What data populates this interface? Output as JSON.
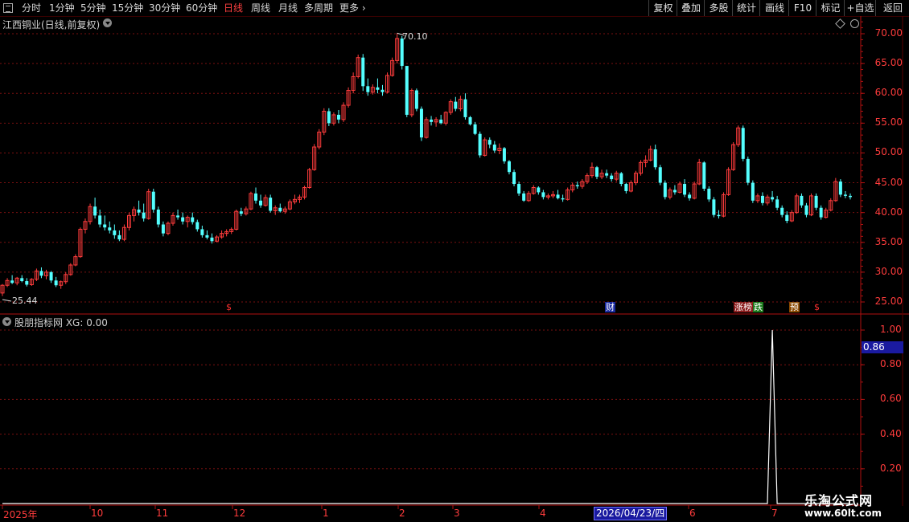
{
  "toolbar": {
    "periods": [
      "分时",
      "1分钟",
      "5分钟",
      "15分钟",
      "30分钟",
      "60分钟",
      "日线",
      "周线",
      "月线",
      "多周期",
      "更多"
    ],
    "active_period": "日线",
    "right_buttons": [
      "复权",
      "叠加",
      "多股",
      "统计",
      "画线",
      "F10",
      "标记",
      "+自选",
      "返回"
    ]
  },
  "main": {
    "title": "江西铜业(日线,前复权)",
    "high_label": "70.10",
    "low_label": "25.44",
    "y_ticks": [
      "70.00",
      "65.00",
      "60.00",
      "55.00",
      "50.00",
      "45.00",
      "40.00",
      "35.00",
      "30.00",
      "25.00"
    ],
    "markers": [
      {
        "text": "$",
        "color": "#ff3030",
        "bg": "#000"
      },
      {
        "text": "财",
        "color": "#ffffff",
        "bg": "#1a2aa0"
      },
      {
        "text": "涨榜",
        "color": "#ffffff",
        "bg": "#8a1a1a"
      },
      {
        "text": "跌",
        "color": "#ffffff",
        "bg": "#1a7a1a"
      },
      {
        "text": "预",
        "color": "#ffffff",
        "bg": "#8a4a00"
      },
      {
        "text": "$",
        "color": "#ff3030",
        "bg": "#000"
      }
    ]
  },
  "indicator": {
    "title": "股朋指标网 XG: 0.00",
    "y_ticks": [
      "1.00",
      "0.80",
      "0.60",
      "0.40",
      "0.20"
    ],
    "current_value": "0.86"
  },
  "date_axis": {
    "labels": [
      "2025年",
      "10",
      "11",
      "12",
      "1",
      "2",
      "3",
      "4",
      "6",
      "7"
    ],
    "selected": "2026/04/23/四"
  },
  "watermark": {
    "line1": "乐淘公式网",
    "line2": "www.60lt.com"
  },
  "colors": {
    "up": "#ff3c3c",
    "down": "#54ffff",
    "grid": "#7a1010",
    "indicator_line": "#ffffff",
    "frame": "#b01010"
  },
  "chart_data": {
    "type": "candlestick",
    "ylim": [
      24,
      71
    ],
    "candles": [
      [
        26.5,
        28,
        26,
        27.8
      ],
      [
        27.8,
        29,
        27.5,
        28.6
      ],
      [
        28.6,
        29.5,
        28,
        28.2
      ],
      [
        28.2,
        29.2,
        27.8,
        29
      ],
      [
        29,
        29.5,
        28.3,
        28.5
      ],
      [
        28.5,
        29,
        27.6,
        27.9
      ],
      [
        27.9,
        29,
        27.7,
        28.8
      ],
      [
        28.8,
        30.6,
        28.5,
        30.2
      ],
      [
        30.2,
        30.8,
        29,
        29.4
      ],
      [
        29.4,
        30.4,
        28.8,
        30
      ],
      [
        30,
        30.2,
        28.2,
        28.6
      ],
      [
        28.6,
        29.2,
        27.5,
        27.8
      ],
      [
        27.8,
        28.6,
        27.2,
        28.4
      ],
      [
        28.4,
        30,
        28,
        29.6
      ],
      [
        29.6,
        31.5,
        29.4,
        31.2
      ],
      [
        31.2,
        33,
        31,
        32.6
      ],
      [
        32.6,
        37.5,
        32.4,
        37.2
      ],
      [
        37.2,
        39,
        36.5,
        38.5
      ],
      [
        38.5,
        41.5,
        38,
        41
      ],
      [
        41,
        42.5,
        39,
        39.5
      ],
      [
        39.5,
        40.5,
        37.5,
        38
      ],
      [
        38,
        39.5,
        37,
        37.5
      ],
      [
        37.5,
        38.5,
        36.5,
        37
      ],
      [
        37,
        38,
        35.6,
        36.2
      ],
      [
        36.2,
        37,
        35.2,
        35.5
      ],
      [
        35.5,
        38,
        35.2,
        37.5
      ],
      [
        37.5,
        40,
        37,
        39.5
      ],
      [
        39.5,
        41,
        38.5,
        40.5
      ],
      [
        40.5,
        42,
        39.5,
        40
      ],
      [
        40,
        41.5,
        38.5,
        39
      ],
      [
        39,
        44,
        38.8,
        43.5
      ],
      [
        43.5,
        44,
        40,
        40.5
      ],
      [
        40.5,
        41,
        37.5,
        38
      ],
      [
        38,
        38.5,
        36,
        36.5
      ],
      [
        36.5,
        38.5,
        36.2,
        38.2
      ],
      [
        38.2,
        40,
        37.8,
        39.5
      ],
      [
        39.5,
        40.5,
        38.8,
        39.2
      ],
      [
        39.2,
        40,
        38,
        38.5
      ],
      [
        38.5,
        39.5,
        37.5,
        39.2
      ],
      [
        39.2,
        40,
        38,
        38.4
      ],
      [
        38.4,
        38.8,
        36.8,
        37.2
      ],
      [
        37.2,
        37.8,
        35.8,
        36.2
      ],
      [
        36.2,
        37,
        35.5,
        35.8
      ],
      [
        35.8,
        36.5,
        34.8,
        35.2
      ],
      [
        35.2,
        36.2,
        35,
        35.9
      ],
      [
        35.9,
        37,
        35.6,
        36.5
      ],
      [
        36.5,
        37.2,
        36,
        36.8
      ],
      [
        36.8,
        37.5,
        36.4,
        37.2
      ],
      [
        37.2,
        40.5,
        37,
        40.2
      ],
      [
        40.2,
        40.8,
        39.4,
        39.8
      ],
      [
        39.8,
        41,
        39.5,
        40.6
      ],
      [
        40.6,
        43.5,
        40.4,
        43.2
      ],
      [
        43.2,
        44.2,
        41.5,
        42
      ],
      [
        42,
        43,
        40.8,
        41.2
      ],
      [
        41.2,
        43,
        41,
        42.5
      ],
      [
        42.5,
        43,
        40,
        40.3
      ],
      [
        40.3,
        41.2,
        39.6,
        40.8
      ],
      [
        40.8,
        41.5,
        40,
        40.2
      ],
      [
        40.2,
        41,
        39.8,
        40.6
      ],
      [
        40.6,
        42.2,
        40.4,
        41.8
      ],
      [
        41.8,
        43,
        41.4,
        42.2
      ],
      [
        42.2,
        43,
        41.6,
        42.6
      ],
      [
        42.6,
        44.5,
        42.2,
        44.2
      ],
      [
        44.2,
        47.5,
        44,
        47.2
      ],
      [
        47.2,
        51.5,
        47,
        51
      ],
      [
        51,
        54,
        50.6,
        53.5
      ],
      [
        53.5,
        57.5,
        53,
        57
      ],
      [
        57,
        57.5,
        54.5,
        55
      ],
      [
        55,
        56.8,
        54.6,
        56.4
      ],
      [
        56.4,
        57.2,
        55,
        55.6
      ],
      [
        55.6,
        58.5,
        55.2,
        58
      ],
      [
        58,
        61,
        57.6,
        60.5
      ],
      [
        60.5,
        63.5,
        60,
        62.8
      ],
      [
        62.8,
        66.5,
        62.5,
        66
      ],
      [
        66,
        66.6,
        60.4,
        61.2
      ],
      [
        61.2,
        62.5,
        59.6,
        60.2
      ],
      [
        60.2,
        61.5,
        59.8,
        61
      ],
      [
        61,
        62.5,
        60,
        60.6
      ],
      [
        60.6,
        61.4,
        59.6,
        60.2
      ],
      [
        60.2,
        63.5,
        60,
        63
      ],
      [
        63,
        66,
        62.8,
        65.5
      ],
      [
        65.5,
        70.1,
        65,
        69.2
      ],
      [
        69.2,
        69.6,
        64,
        64.6
      ],
      [
        64.6,
        61,
        56,
        56.4
      ],
      [
        56.4,
        60.8,
        56,
        60.5
      ],
      [
        60.5,
        60.8,
        57,
        57.4
      ],
      [
        57.4,
        57.8,
        52,
        52.6
      ],
      [
        52.6,
        56,
        52.4,
        55.6
      ],
      [
        55.6,
        56.2,
        54.6,
        55.2
      ],
      [
        55.2,
        56,
        54.4,
        55.6
      ],
      [
        55.6,
        56.4,
        54.8,
        55
      ],
      [
        55,
        57,
        54.6,
        56.8
      ],
      [
        56.8,
        59,
        56.4,
        58.6
      ],
      [
        58.6,
        59.4,
        57,
        57.4
      ],
      [
        57.4,
        59.6,
        57,
        59
      ],
      [
        59,
        60,
        55.6,
        56
      ],
      [
        56,
        56.2,
        54.6,
        54.8
      ],
      [
        54.8,
        55.2,
        53,
        53.2
      ],
      [
        53.2,
        53.6,
        49.2,
        49.6
      ],
      [
        49.6,
        52.6,
        49.4,
        52.2
      ],
      [
        52.2,
        52.6,
        50.8,
        51.4
      ],
      [
        51.4,
        52,
        50,
        50.4
      ],
      [
        50.4,
        51.6,
        49.8,
        50.8
      ],
      [
        50.8,
        51,
        48.2,
        48.6
      ],
      [
        48.6,
        48.8,
        46.4,
        46.8
      ],
      [
        46.8,
        47.2,
        44.4,
        44.8
      ],
      [
        44.8,
        45.2,
        42.8,
        43.2
      ],
      [
        43.2,
        43.6,
        41.8,
        42
      ],
      [
        42,
        43.6,
        41.8,
        43.2
      ],
      [
        43.2,
        44.6,
        43,
        44.2
      ],
      [
        44.2,
        44.4,
        43,
        43.4
      ],
      [
        43.4,
        43.8,
        42.2,
        42.6
      ],
      [
        42.6,
        43.2,
        42.2,
        42.8
      ],
      [
        42.8,
        43.6,
        42.4,
        43
      ],
      [
        43,
        43.8,
        42.2,
        42.4
      ],
      [
        42.4,
        43,
        41.8,
        42.2
      ],
      [
        42.2,
        44.2,
        42,
        43.8
      ],
      [
        43.8,
        45,
        43.4,
        44.6
      ],
      [
        44.6,
        45.2,
        44,
        44.4
      ],
      [
        44.4,
        45.6,
        44,
        45.2
      ],
      [
        45.2,
        46.6,
        44.8,
        46.2
      ],
      [
        46.2,
        48.4,
        45.8,
        47.6
      ],
      [
        47.6,
        47.8,
        45.6,
        46
      ],
      [
        46,
        47.2,
        45.6,
        46.6
      ],
      [
        46.6,
        47.2,
        45.8,
        46.2
      ],
      [
        46.2,
        46.6,
        45.2,
        45.6
      ],
      [
        45.6,
        47,
        45.2,
        46.6
      ],
      [
        46.6,
        46.8,
        44.4,
        44.8
      ],
      [
        44.8,
        45,
        43.2,
        43.6
      ],
      [
        43.6,
        45.4,
        43.4,
        45
      ],
      [
        45,
        47,
        44.6,
        46.6
      ],
      [
        46.6,
        48.8,
        46.2,
        48.4
      ],
      [
        48.4,
        49.6,
        47.6,
        48.8
      ],
      [
        48.8,
        51.2,
        48.6,
        50.6
      ],
      [
        50.6,
        51.4,
        47.2,
        47.6
      ],
      [
        47.6,
        48,
        44.6,
        45
      ],
      [
        45,
        45.4,
        42.2,
        42.6
      ],
      [
        42.6,
        44.2,
        42.2,
        43.8
      ],
      [
        43.8,
        44.6,
        43,
        43.4
      ],
      [
        43.4,
        45.2,
        43.2,
        44.8
      ],
      [
        44.8,
        45.6,
        42.6,
        43
      ],
      [
        43,
        43.4,
        42,
        42.4
      ],
      [
        42.4,
        45.2,
        42.2,
        44.8
      ],
      [
        44.8,
        49,
        44.6,
        48.4
      ],
      [
        48.4,
        48.6,
        43.6,
        44
      ],
      [
        44,
        44.4,
        41.8,
        42.2
      ],
      [
        42.2,
        42.6,
        39.2,
        39.6
      ],
      [
        39.6,
        40.4,
        39,
        39.4
      ],
      [
        39.4,
        43.4,
        39.2,
        43
      ],
      [
        43,
        47.6,
        42.8,
        47.2
      ],
      [
        47.2,
        51.8,
        47,
        51.4
      ],
      [
        51.4,
        54.6,
        51,
        54.2
      ],
      [
        54.2,
        54.6,
        48.6,
        49
      ],
      [
        49,
        49.4,
        44.6,
        45
      ],
      [
        45,
        45.4,
        41.6,
        42
      ],
      [
        42,
        43.2,
        41.6,
        42.8
      ],
      [
        42.8,
        43.4,
        41.2,
        41.6
      ],
      [
        41.6,
        43,
        41.2,
        42.6
      ],
      [
        42.6,
        43.6,
        41.8,
        42.2
      ],
      [
        42.2,
        42.8,
        40.4,
        40.8
      ],
      [
        40.8,
        41.2,
        39.2,
        39.6
      ],
      [
        39.6,
        40.2,
        38.2,
        38.6
      ],
      [
        38.6,
        40.4,
        38.4,
        40
      ],
      [
        40,
        43.2,
        39.8,
        42.8
      ],
      [
        42.8,
        43.2,
        40.8,
        41.2
      ],
      [
        41.2,
        41.6,
        39.2,
        39.6
      ],
      [
        39.6,
        43.2,
        39.4,
        42.8
      ],
      [
        42.8,
        43.2,
        40.4,
        40.8
      ],
      [
        40.8,
        41.2,
        38.8,
        39.2
      ],
      [
        39.2,
        40.8,
        39,
        40.4
      ],
      [
        40.4,
        42.4,
        40.2,
        42
      ],
      [
        42,
        45.8,
        41.8,
        45.2
      ],
      [
        45.2,
        45.6,
        42.6,
        43
      ],
      [
        43,
        43.6,
        42.4,
        42.8
      ],
      [
        42.8,
        43.2,
        42.2,
        42.6
      ]
    ],
    "indicator": {
      "name": "XG",
      "ylim": [
        0,
        1.05
      ],
      "values_note": "0 except spike at candle index 158 reaching 1.00"
    }
  }
}
